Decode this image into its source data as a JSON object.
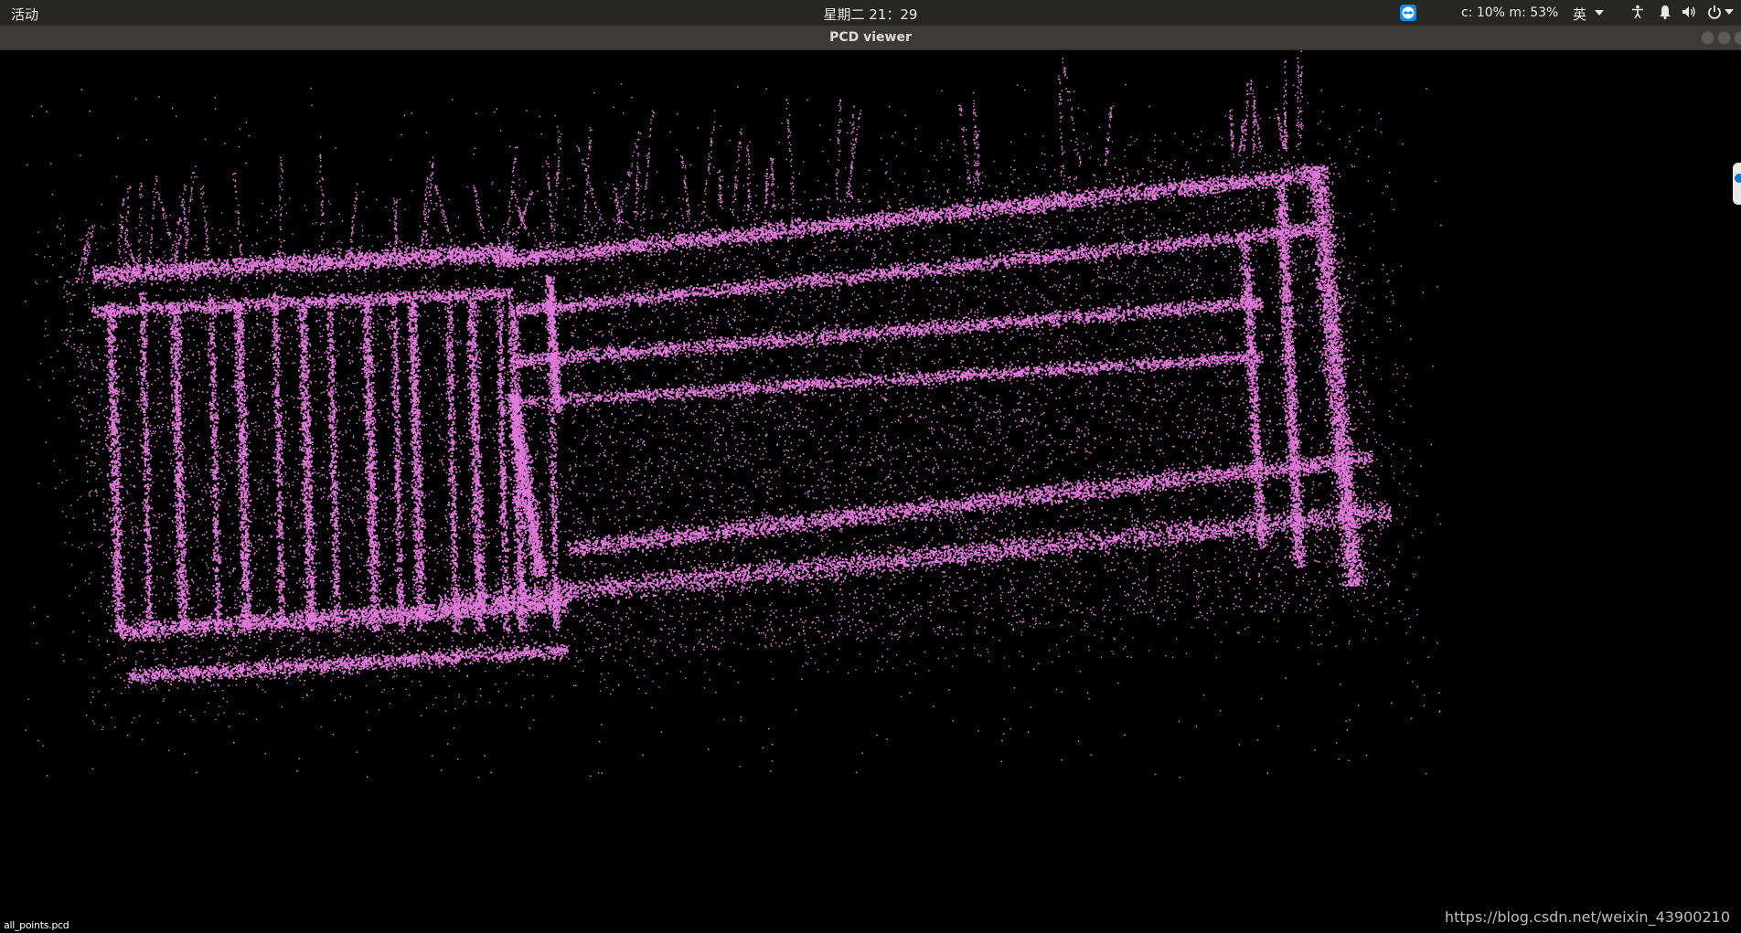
{
  "topbar": {
    "activities": "活动",
    "clock": "星期二 21：29",
    "system_monitor": "c: 10% m: 53%",
    "input_method": "英"
  },
  "window": {
    "title": "PCD viewer"
  },
  "viewer": {
    "point_color": "#e07ad9",
    "background": "#000000",
    "cloud_file": "all_points.pcd"
  },
  "watermark": "https://blog.csdn.net/weixin_43900210",
  "icons": {
    "teamviewer": "teamviewer-icon",
    "accessibility": "accessibility-icon",
    "notification": "notification-bell-icon",
    "volume": "volume-icon",
    "power": "power-icon"
  }
}
